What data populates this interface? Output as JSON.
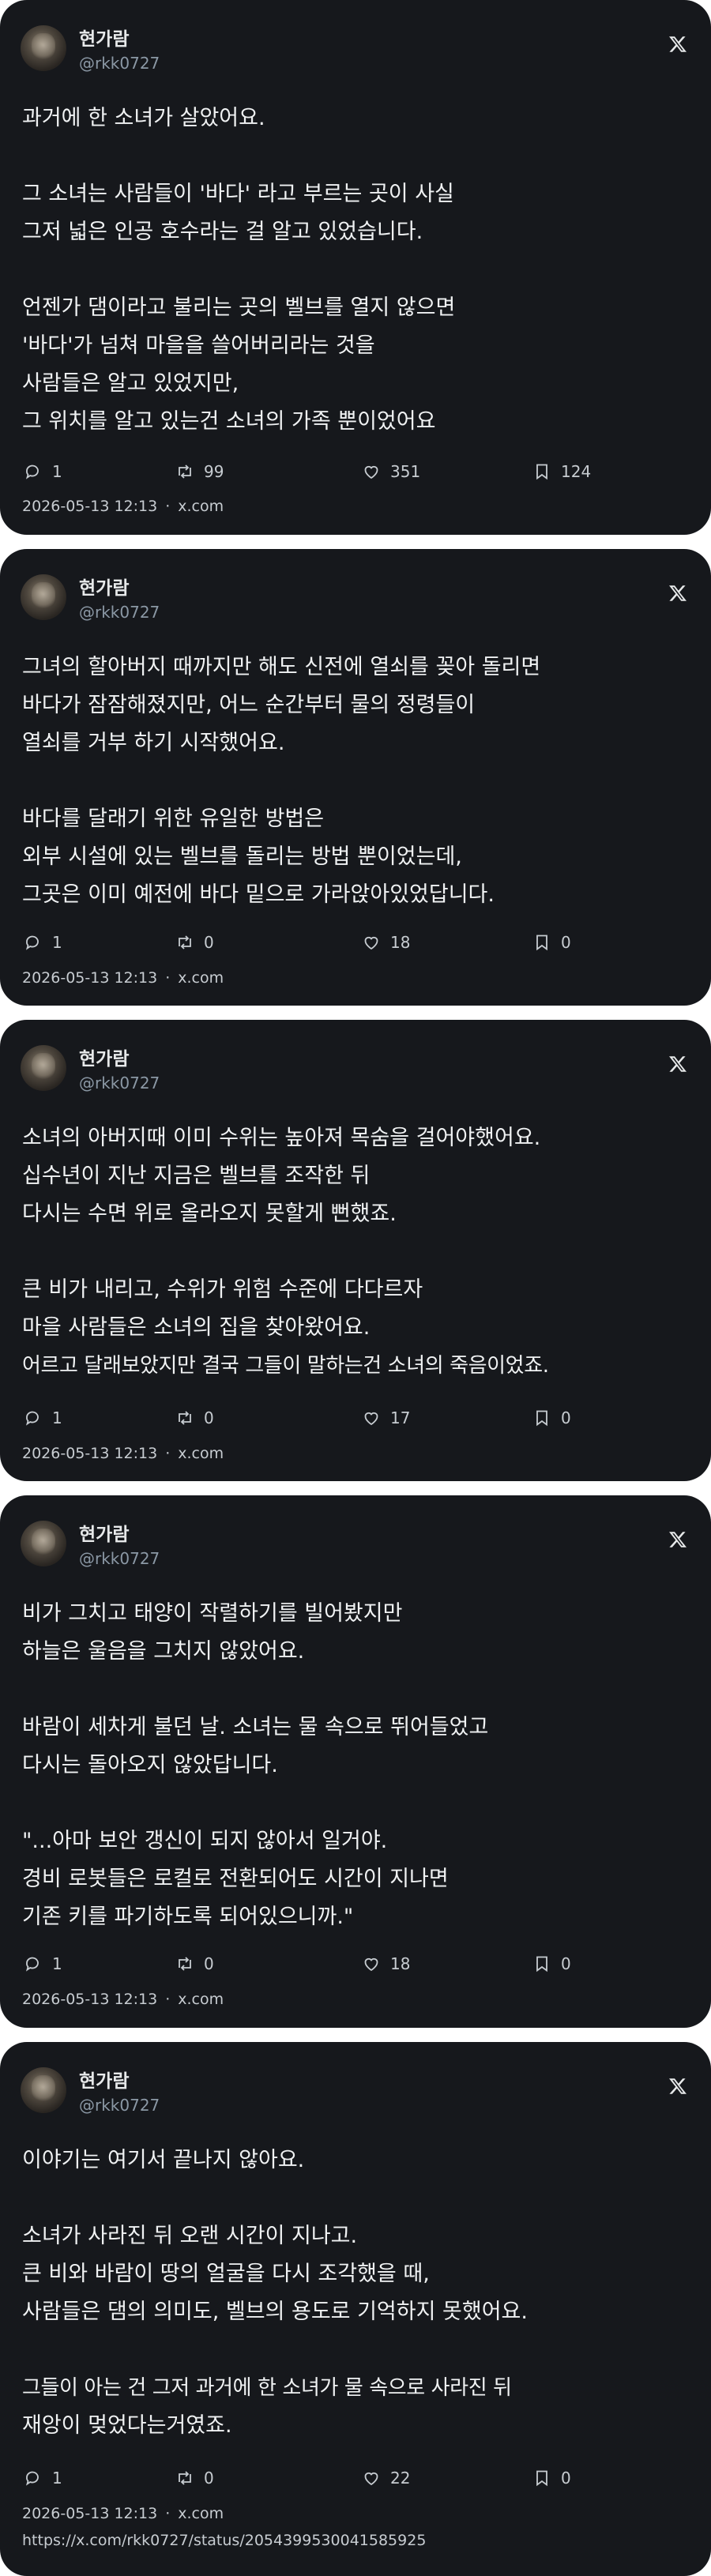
{
  "author": {
    "name": "현가람",
    "handle": "@rkk0727"
  },
  "icons": {
    "reply": "speech-bubble-icon",
    "repost": "repost-icon",
    "like": "heart-icon",
    "views": "bookmark-icon",
    "brand": "x-logo-icon"
  },
  "tweets": [
    {
      "lines": [
        "과거에 한 소녀가 살았어요.",
        "",
        "그 소녀는 사람들이 '바다' 라고 부르는 곳이 사실",
        "그저 넓은 인공 호수라는 걸 알고 있었습니다.",
        "",
        "언젠가 댐이라고 불리는 곳의 벨브를 열지 않으면",
        "'바다'가 넘쳐 마을을 쓸어버리라는 것을",
        "사람들은 알고 있었지만,",
        "그 위치를 알고 있는건 소녀의 가족 뿐이었어요"
      ],
      "replies": "1",
      "reposts": "99",
      "likes": "351",
      "views": "124",
      "date": "2026-05-13 12:13",
      "source": "x.com"
    },
    {
      "lines": [
        "그녀의 할아버지 때까지만 해도 신전에 열쇠를 꽂아 돌리면",
        "바다가 잠잠해졌지만, 어느 순간부터 물의 정령들이",
        "열쇠를 거부 하기 시작했어요.",
        "",
        "바다를 달래기 위한 유일한 방법은",
        "외부 시설에 있는 벨브를 돌리는 방법 뿐이었는데,",
        "그곳은 이미 예전에 바다 밑으로 가라앉아있었답니다."
      ],
      "replies": "1",
      "reposts": "0",
      "likes": "18",
      "views": "0",
      "date": "2026-05-13 12:13",
      "source": "x.com"
    },
    {
      "lines": [
        "소녀의 아버지때 이미 수위는 높아져 목숨을 걸어야했어요.",
        "십수년이 지난 지금은 벨브를 조작한 뒤",
        "다시는 수면 위로 올라오지 못할게 뻔했죠.",
        "",
        "큰 비가 내리고, 수위가 위험 수준에 다다르자",
        "마을 사람들은 소녀의 집을 찾아왔어요.",
        "어르고 달래보았지만 결국 그들이 말하는건 소녀의 죽음이었죠."
      ],
      "replies": "1",
      "reposts": "0",
      "likes": "17",
      "views": "0",
      "date": "2026-05-13 12:13",
      "source": "x.com"
    },
    {
      "lines": [
        "비가 그치고 태양이 작렬하기를 빌어봤지만",
        "하늘은 울음을 그치지 않았어요.",
        "",
        "바람이 세차게 불던 날. 소녀는 물 속으로 뛰어들었고",
        "다시는 돌아오지 않았답니다.",
        "",
        "\"...아마 보안 갱신이 되지 않아서 일거야.",
        "경비 로봇들은 로컬로 전환되어도 시간이 지나면",
        "기존 키를 파기하도록 되어있으니까.\""
      ],
      "replies": "1",
      "reposts": "0",
      "likes": "18",
      "views": "0",
      "date": "2026-05-13 12:13",
      "source": "x.com"
    },
    {
      "lines": [
        "이야기는 여기서 끝나지 않아요.",
        "",
        "소녀가 사라진 뒤 오랜 시간이 지나고.",
        "큰 비와 바람이 땅의 얼굴을 다시 조각했을 때,",
        "사람들은 댐의 의미도, 벨브의 용도로 기억하지 못했어요.",
        "",
        "그들이 아는 건 그저 과거에 한 소녀가 물 속으로 사라진 뒤",
        "재앙이 멎었다는거였죠."
      ],
      "replies": "1",
      "reposts": "0",
      "likes": "22",
      "views": "0",
      "date": "2026-05-13 12:13",
      "source": "x.com",
      "url": "https://x.com/rkk0727/status/2054399530041585925"
    }
  ]
}
